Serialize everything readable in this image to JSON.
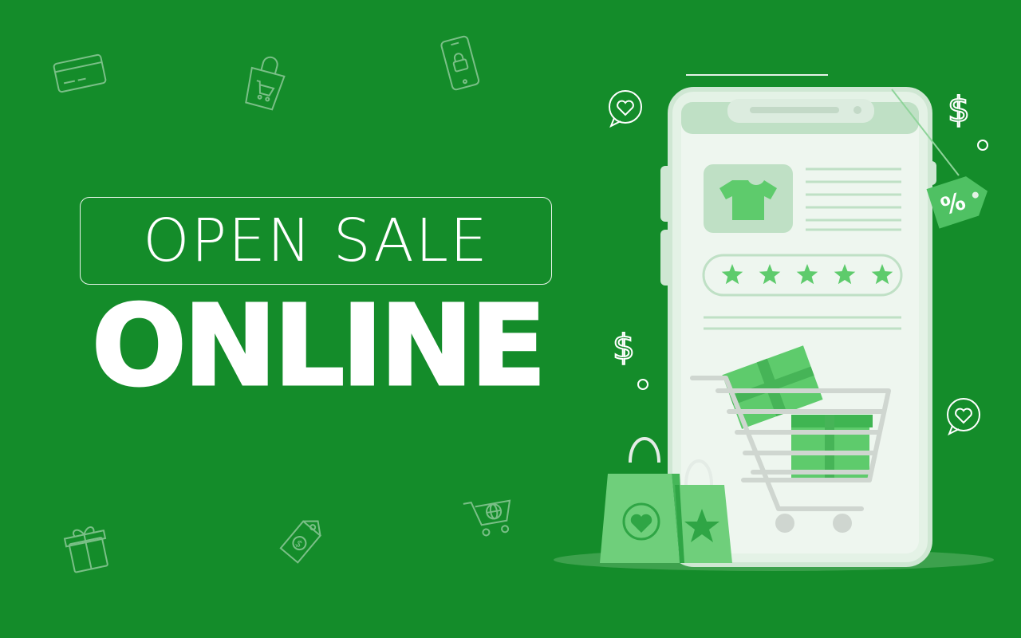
{
  "banner": {
    "title_top": "OPEN SALE",
    "title_main": "ONLINE"
  },
  "illustration": {
    "tag_symbol": "%",
    "currency_symbol": "$",
    "rating_stars": 5,
    "icons": [
      "credit-card-icon",
      "shopping-bag-icon",
      "smartphone-lock-icon",
      "gift-box-icon",
      "price-tag-icon",
      "shopping-cart-globe-icon",
      "heart-chat-icon",
      "dollar-icon",
      "discount-tag-icon",
      "t-shirt-icon",
      "heart-bag-icon",
      "star-bag-icon"
    ]
  },
  "colors": {
    "background": "#148c2a",
    "phone_body": "#e8f4ea",
    "accent_green": "#5ecb6c",
    "dark_accent": "#3fb552",
    "text": "#ffffff"
  }
}
